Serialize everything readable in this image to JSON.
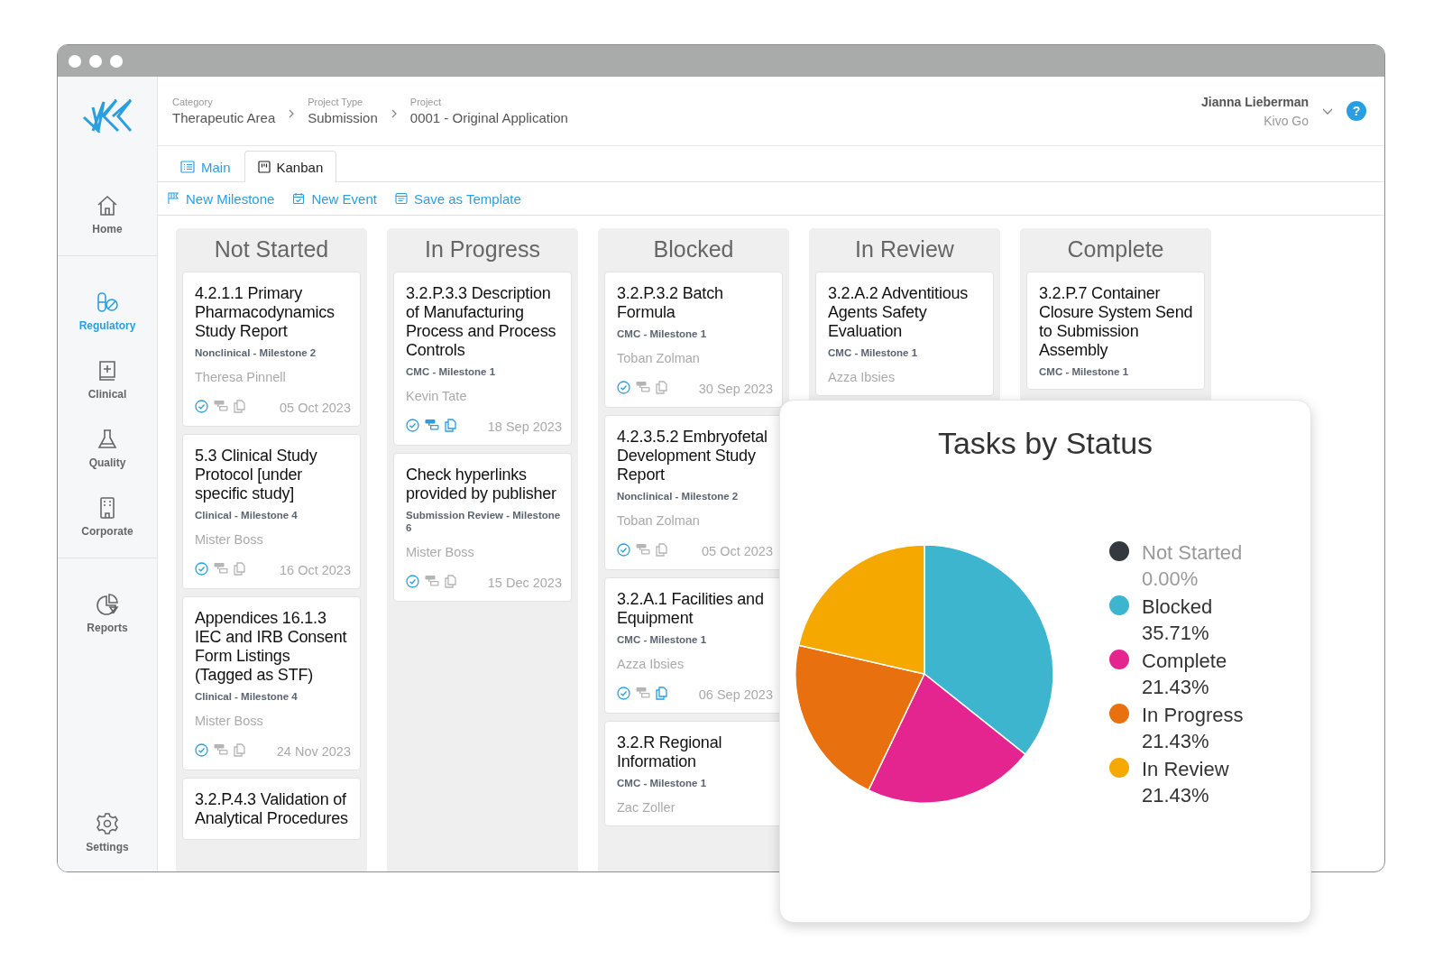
{
  "sidebar": {
    "groups": [
      {
        "items": [
          {
            "label": "Home",
            "selected": false
          }
        ]
      },
      {
        "items": [
          {
            "label": "Regulatory",
            "selected": true
          },
          {
            "label": "Clinical",
            "selected": false
          },
          {
            "label": "Quality",
            "selected": false
          },
          {
            "label": "Corporate",
            "selected": false
          }
        ]
      },
      {
        "items": [
          {
            "label": "Reports",
            "selected": false
          }
        ]
      }
    ],
    "footer": {
      "label": "Settings",
      "selected": false
    }
  },
  "breadcrumbs": [
    {
      "label": "Category",
      "value": "Therapeutic Area"
    },
    {
      "label": "Project Type",
      "value": "Submission"
    },
    {
      "label": "Project",
      "value": "0001 - Original Application"
    }
  ],
  "user": {
    "name": "Jianna Lieberman",
    "org": "Kivo Go"
  },
  "help": "?",
  "tabs": [
    {
      "label": "Main",
      "selected": false
    },
    {
      "label": "Kanban",
      "selected": true
    }
  ],
  "actions": [
    {
      "label": "New Milestone"
    },
    {
      "label": "New Event"
    },
    {
      "label": "Save as Template"
    }
  ],
  "columns": [
    {
      "title": "Not Started",
      "cards": [
        {
          "title": "4.2.1.1 Primary Pharmacodynamics Study Report",
          "meta": "Nonclinical - Milestone 2",
          "assignee": "Theresa Pinnell",
          "date": "05 Oct 2023",
          "check_done": true,
          "comments": false,
          "files": false
        },
        {
          "title": "5.3 Clinical Study Protocol [under specific study]",
          "meta": "Clinical - Milestone 4",
          "assignee": "Mister Boss",
          "date": "16 Oct 2023",
          "check_done": true,
          "comments": false,
          "files": false
        },
        {
          "title": "Appendices 16.1.3 IEC and IRB Consent Form Listings (Tagged as STF)",
          "meta": "Clinical - Milestone 4",
          "assignee": "Mister Boss",
          "date": "24 Nov 2023",
          "check_done": true,
          "comments": false,
          "files": false
        },
        {
          "title": "3.2.P.4.3 Validation of Analytical Procedures"
        }
      ]
    },
    {
      "title": "In Progress",
      "cards": [
        {
          "title": "3.2.P.3.3 Description of Manufacturing Process and Process Controls",
          "meta": "CMC - Milestone 1",
          "assignee": "Kevin Tate",
          "date": "18 Sep 2023",
          "check_done": true,
          "comments": true,
          "files": true
        },
        {
          "title": "Check hyperlinks provided by publisher",
          "meta": "Submission Review - Milestone 6",
          "assignee": "Mister Boss",
          "date": "15 Dec 2023",
          "check_done": true,
          "comments": false,
          "files": false
        }
      ]
    },
    {
      "title": "Blocked",
      "cards": [
        {
          "title": "3.2.P.3.2 Batch Formula",
          "meta": "CMC - Milestone 1",
          "assignee": "Toban Zolman",
          "date": "30 Sep 2023",
          "check_done": true,
          "comments": false,
          "files": false
        },
        {
          "title": "4.2.3.5.2 Embryofetal Development Study Report",
          "meta": "Nonclinical - Milestone 2",
          "assignee": "Toban Zolman",
          "date": "05 Oct 2023",
          "check_done": true,
          "comments": false,
          "files": false
        },
        {
          "title": "3.2.A.1 Facilities and Equipment",
          "meta": "CMC - Milestone 1",
          "assignee": "Azza Ibsies",
          "date": "06 Sep 2023",
          "check_done": true,
          "comments": false,
          "files": true
        },
        {
          "title": "3.2.R Regional Information",
          "meta": "CMC - Milestone 1",
          "assignee": "Zac Zoller"
        }
      ]
    },
    {
      "title": "In Review",
      "cards": [
        {
          "title": "3.2.A.2 Adventitious Agents Safety Evaluation",
          "meta": "CMC - Milestone 1",
          "assignee": "Azza Ibsies"
        }
      ]
    },
    {
      "title": "Complete",
      "cards": [
        {
          "title": "3.2.P.7 Container Closure System Send to Submission Assembly",
          "meta": "CMC - Milestone 1"
        }
      ]
    }
  ],
  "chart": {
    "chart_data": {
      "type": "pie",
      "title": "Tasks by Status",
      "categories": [
        "Not Started",
        "Blocked",
        "Complete",
        "In Progress",
        "In Review"
      ],
      "values": [
        0,
        35.71,
        21.43,
        21.43,
        21.43
      ]
    },
    "legend": [
      {
        "percent": "0.00%",
        "color": "#33393e"
      },
      {
        "percent": "35.71%",
        "color": "#3db5cf"
      },
      {
        "percent": "21.43%",
        "color": "#e5258f"
      },
      {
        "percent": "21.43%",
        "color": "#e8700e"
      },
      {
        "percent": "21.43%",
        "color": "#f5a800"
      }
    ]
  }
}
